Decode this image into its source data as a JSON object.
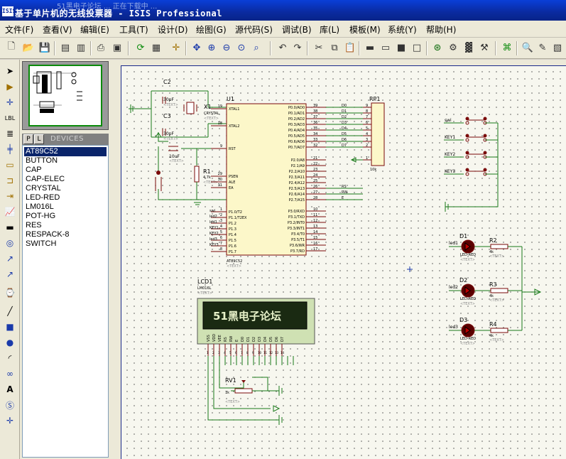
{
  "window": {
    "title": "基于单片机的无线投票器 - ISIS Professional",
    "ghost_text": "51黑电子论坛 ... 正在下载中 ...",
    "logo": "ISIS"
  },
  "menu": [
    "文件(F)",
    "查看(V)",
    "编辑(E)",
    "工具(T)",
    "设计(D)",
    "绘图(G)",
    "源代码(S)",
    "调试(B)",
    "库(L)",
    "模板(M)",
    "系统(Y)",
    "帮助(H)"
  ],
  "device_panel": {
    "tab_p": "P",
    "tab_l": "L",
    "header": "DEVICES",
    "items": [
      "AT89C52",
      "BUTTON",
      "CAP",
      "CAP-ELEC",
      "CRYSTAL",
      "LED-RED",
      "LM016L",
      "POT-HG",
      "RES",
      "RESPACK-8",
      "SWITCH"
    ],
    "selected_index": 0
  },
  "schematic": {
    "c2": {
      "ref": "C2",
      "value": "30pF",
      "text": "<TEXT>"
    },
    "c3": {
      "ref": "C3",
      "value": "30pF",
      "text": "<TEXT>"
    },
    "x1": {
      "ref": "X1",
      "value": "CRYSTAL",
      "text": "<TEXT>"
    },
    "c_reset": {
      "value": "10uF",
      "text": "<TEXT>"
    },
    "r1": {
      "ref": "R1",
      "value": "4.7k",
      "text": "<TEXT>"
    },
    "u1": {
      "ref": "U1",
      "part": "AT89C52",
      "text": "<TEXT>",
      "left_pins": [
        {
          "num": "19",
          "name": "XTAL1"
        },
        {
          "num": "18",
          "name": "XTAL2"
        },
        {
          "num": "9",
          "name": "RST"
        },
        {
          "num": "29",
          "name": "PSEN"
        },
        {
          "num": "30",
          "name": "ALE"
        },
        {
          "num": "31",
          "name": "EA"
        },
        {
          "num": "1",
          "name": "P1.0/T2",
          "net": "swi"
        },
        {
          "num": "2",
          "name": "P1.1/T2EX",
          "net": "led2"
        },
        {
          "num": "3",
          "name": "P1.2",
          "net": "led1"
        },
        {
          "num": "4",
          "name": "P1.3",
          "net": "KEY1"
        },
        {
          "num": "5",
          "name": "P1.4",
          "net": "KEY2"
        },
        {
          "num": "6",
          "name": "P1.5",
          "net": "led3"
        },
        {
          "num": "7",
          "name": "P1.6",
          "net": "KEY3"
        },
        {
          "num": "8",
          "name": "P1.7"
        }
      ],
      "right_pins": [
        {
          "num": "39",
          "name": "P0.0/AD0",
          "net": "D0"
        },
        {
          "num": "38",
          "name": "P0.1/AD1",
          "net": "D1"
        },
        {
          "num": "37",
          "name": "P0.2/AD2",
          "net": "D2"
        },
        {
          "num": "36",
          "name": "P0.3/AD3",
          "net": "D3"
        },
        {
          "num": "35",
          "name": "P0.4/AD4",
          "net": "D4"
        },
        {
          "num": "34",
          "name": "P0.5/AD5",
          "net": "D5"
        },
        {
          "num": "33",
          "name": "P0.6/AD6",
          "net": "D6"
        },
        {
          "num": "32",
          "name": "P0.7/AD7",
          "net": "D7"
        },
        {
          "num": "21",
          "name": "P2.0/A8"
        },
        {
          "num": "22",
          "name": "P2.1/A9"
        },
        {
          "num": "23",
          "name": "P2.2/A10"
        },
        {
          "num": "24",
          "name": "P2.3/A11"
        },
        {
          "num": "25",
          "name": "P2.4/A12"
        },
        {
          "num": "26",
          "name": "P2.5/A13",
          "net": "RS"
        },
        {
          "num": "27",
          "name": "P2.6/A14",
          "net": "RW"
        },
        {
          "num": "28",
          "name": "P2.7/A15",
          "net": "E"
        },
        {
          "num": "10",
          "name": "P3.0/RXD"
        },
        {
          "num": "11",
          "name": "P3.1/TXD"
        },
        {
          "num": "12",
          "name": "P3.2/INT0"
        },
        {
          "num": "13",
          "name": "P3.3/INT1"
        },
        {
          "num": "14",
          "name": "P3.4/T0"
        },
        {
          "num": "15",
          "name": "P3.5/T1"
        },
        {
          "num": "16",
          "name": "P3.6/WR"
        },
        {
          "num": "17",
          "name": "P3.7/RD"
        }
      ]
    },
    "rp1": {
      "ref": "RP1",
      "value": "10k",
      "pins": [
        "9",
        "8",
        "7",
        "6",
        "5",
        "4",
        "3",
        "2",
        "1"
      ]
    },
    "switches": [
      {
        "net": "swi"
      },
      {
        "net": "KEY1"
      },
      {
        "net": "KEY2"
      },
      {
        "net": "KEY3"
      }
    ],
    "leds": [
      {
        "ref": "D1",
        "net": "led1",
        "part": "LED-RED",
        "text": "<TEXT>",
        "res": "R2",
        "res_val": "4k"
      },
      {
        "ref": "D2",
        "net": "led2",
        "part": "LED-RED",
        "text": "<TEXT>",
        "res": "R3",
        "res_val": "4k"
      },
      {
        "ref": "D3",
        "net": "led3",
        "part": "LED-RED",
        "text": "<TEXT>",
        "res": "R4",
        "res_val": "4k"
      }
    ],
    "lcd": {
      "ref": "LCD1",
      "part": "LM016L",
      "text": "<TEXT>",
      "display": "51黑电子论坛",
      "pins": [
        "VSS",
        "VDD",
        "VEE",
        "RS",
        "RW",
        "E",
        "D0",
        "D1",
        "D2",
        "D3",
        "D4",
        "D5",
        "D6",
        "D7"
      ],
      "pin_nums": [
        "1",
        "2",
        "3",
        "4",
        "5",
        "6",
        "7",
        "8",
        "9",
        "10",
        "11",
        "12",
        "13",
        "14"
      ]
    },
    "rv1": {
      "ref": "RV1",
      "value": "1k",
      "text": "<TEXT>"
    }
  }
}
